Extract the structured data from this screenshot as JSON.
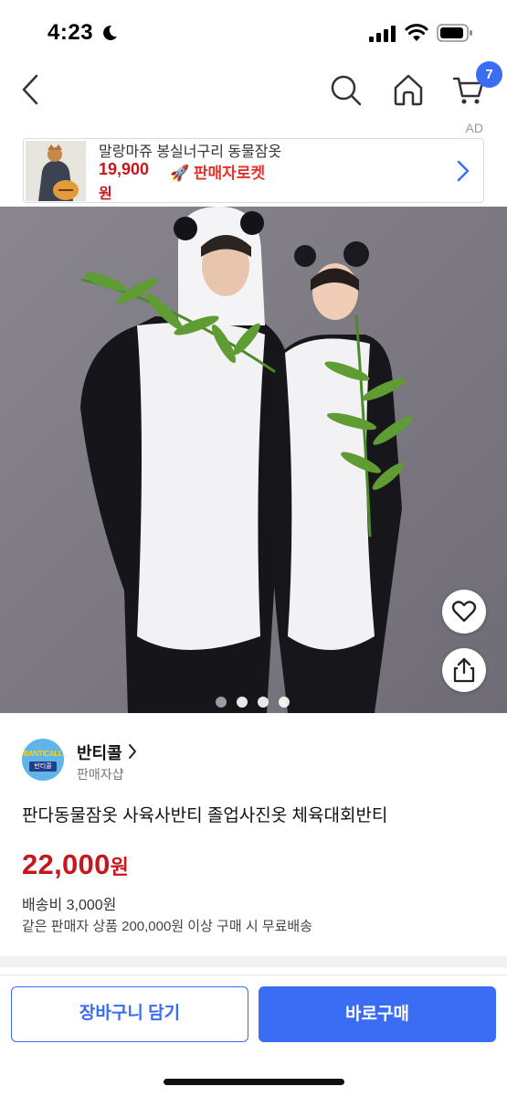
{
  "status_bar": {
    "time": "4:23"
  },
  "nav": {
    "cart_count": "7"
  },
  "ad": {
    "label": "AD",
    "title": "말랑마쥬 봉실너구리 동물잠옷",
    "price": "19,900",
    "price_unit": "원",
    "rocket_label": "🚀 판매자로켓",
    "accent_color": "#c8161d"
  },
  "gallery": {
    "total": 4,
    "active_index": 0
  },
  "seller": {
    "logo_text": "BANTICALL",
    "logo_sub": "반티콜",
    "name": "반티콜",
    "type": "판매자샵"
  },
  "product": {
    "title": "판다동물잠옷 사육사반티 졸업사진옷 체육대회반티",
    "price": "22,000",
    "price_unit": "원",
    "shipping": "배송비 3,000원",
    "free_shipping_note": "같은 판매자 상품 200,000원 이상 구매 시 무료배송"
  },
  "actions": {
    "add_to_cart": "장바구니 담기",
    "buy_now": "바로구매",
    "primary_color": "#3a6cf4"
  },
  "icons": [
    "moon-icon",
    "signal-icon",
    "wifi-icon",
    "battery-icon",
    "back-icon",
    "search-icon",
    "home-icon",
    "cart-icon",
    "chevron-right-icon",
    "heart-icon",
    "share-icon"
  ]
}
